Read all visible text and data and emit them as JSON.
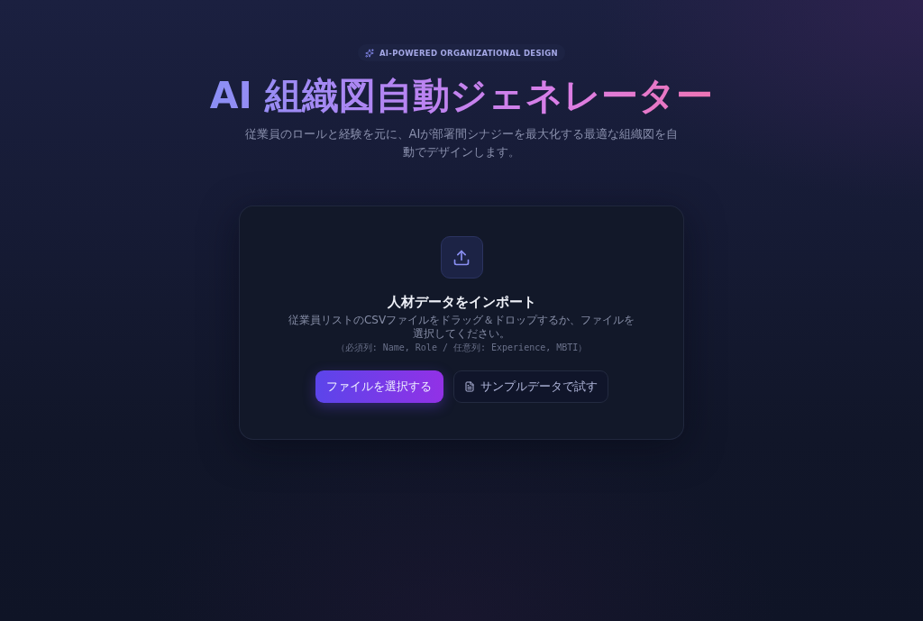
{
  "badge": {
    "label": "AI-POWERED ORGANIZATIONAL DESIGN"
  },
  "title": "AI 組織図自動ジェネレーター",
  "subtitle": "従業員のロールと経験を元に、AIが部署間シナジーを最大化する最適な組織図を自動でデザインします。",
  "import_card": {
    "heading": "人材データをインポート",
    "description": "従業員リストのCSVファイルをドラッグ＆ドロップするか、ファイルを選択してください。",
    "hint": "（必須列: Name, Role / 任意列: Experience, MBTI）",
    "buttons": [
      {
        "label": "ファイルを選択する",
        "kind": "primary"
      },
      {
        "label": "サンプルデータで試す",
        "kind": "secondary"
      }
    ]
  }
}
